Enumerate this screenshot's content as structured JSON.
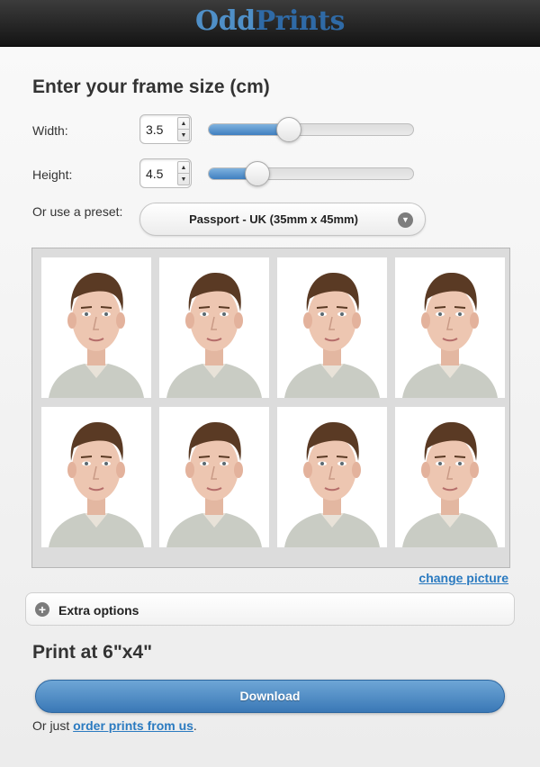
{
  "header": {
    "logo_part1": "Odd",
    "logo_part2": "Prints"
  },
  "frame": {
    "heading": "Enter your frame size (cm)",
    "width_label": "Width:",
    "width_value": "3.5",
    "width_slider_fraction": 0.39,
    "height_label": "Height:",
    "height_value": "4.5",
    "height_slider_fraction": 0.24,
    "preset_label": "Or use a preset:",
    "preset_value": "Passport - UK (35mm x 45mm)"
  },
  "photos": {
    "count": 8
  },
  "change_picture_label": "change picture",
  "extra_options_label": "Extra options",
  "print_title": "Print at 6\"x4\"",
  "download_label": "Download",
  "footer": {
    "prefix": "Or just ",
    "link": "order prints from us",
    "suffix": "."
  },
  "colors": {
    "accent": "#2a7ac0",
    "button": "#3a78b6",
    "header": "#1e1e1e"
  }
}
